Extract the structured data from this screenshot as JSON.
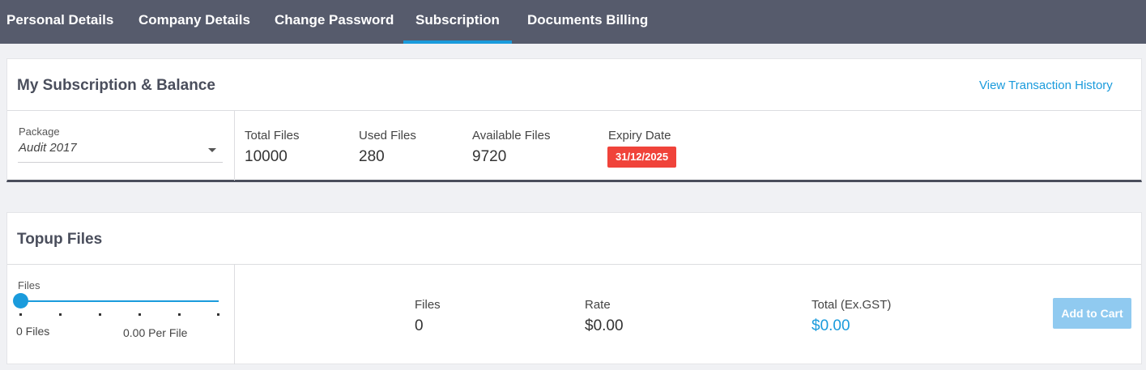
{
  "tabs": [
    {
      "label": "Personal Details"
    },
    {
      "label": "Company Details"
    },
    {
      "label": "Change Password"
    },
    {
      "label": "Subscription"
    },
    {
      "label": "Documents Billing"
    }
  ],
  "active_tab": "Subscription",
  "subscription": {
    "title": "My Subscription & Balance",
    "history_link": "View Transaction History",
    "package_label": "Package",
    "package_value": "Audit 2017",
    "total_files_label": "Total Files",
    "total_files_value": "10000",
    "used_files_label": "Used Files",
    "used_files_value": "280",
    "available_files_label": "Available Files",
    "available_files_value": "9720",
    "expiry_label": "Expiry Date",
    "expiry_value": "31/12/2025",
    "expiry_color": "#f0433a"
  },
  "topup": {
    "title": "Topup Files",
    "slider_label": "Files",
    "slider_value_fraction": 0,
    "slider_files_text": "0 Files",
    "slider_rate_text": "0.00 Per File",
    "files_label": "Files",
    "files_value": "0",
    "rate_label": "Rate",
    "rate_value": "$0.00",
    "total_label": "Total (Ex.GST)",
    "total_value": "$0.00",
    "add_to_cart_label": "Add to Cart"
  },
  "colors": {
    "accent": "#1a9bdc",
    "tabbar": "#565b6c",
    "button_disabled": "#90caf0"
  }
}
